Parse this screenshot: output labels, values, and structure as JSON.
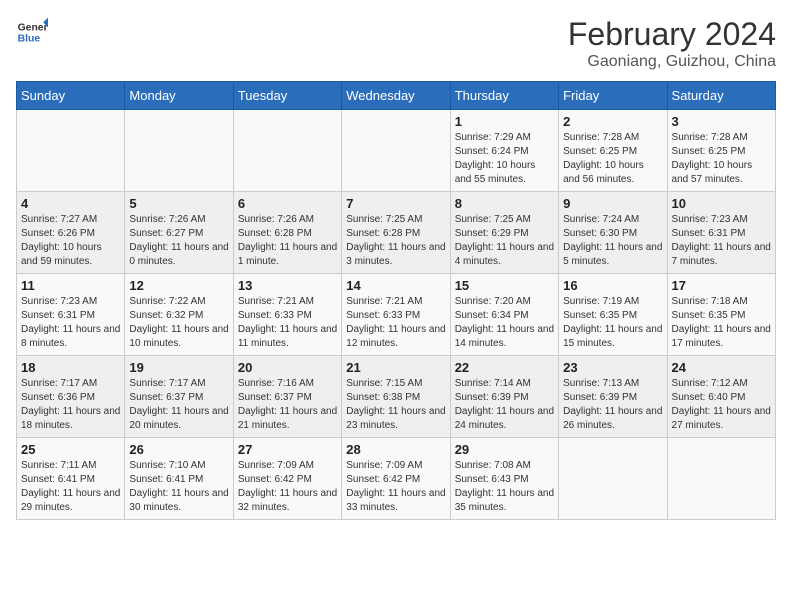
{
  "logo": {
    "line1": "General",
    "line2": "Blue"
  },
  "header": {
    "month": "February 2024",
    "location": "Gaoniang, Guizhou, China"
  },
  "weekdays": [
    "Sunday",
    "Monday",
    "Tuesday",
    "Wednesday",
    "Thursday",
    "Friday",
    "Saturday"
  ],
  "weeks": [
    [
      {
        "day": "",
        "sunrise": "",
        "sunset": "",
        "daylight": ""
      },
      {
        "day": "",
        "sunrise": "",
        "sunset": "",
        "daylight": ""
      },
      {
        "day": "",
        "sunrise": "",
        "sunset": "",
        "daylight": ""
      },
      {
        "day": "",
        "sunrise": "",
        "sunset": "",
        "daylight": ""
      },
      {
        "day": "1",
        "sunrise": "Sunrise: 7:29 AM",
        "sunset": "Sunset: 6:24 PM",
        "daylight": "Daylight: 10 hours and 55 minutes."
      },
      {
        "day": "2",
        "sunrise": "Sunrise: 7:28 AM",
        "sunset": "Sunset: 6:25 PM",
        "daylight": "Daylight: 10 hours and 56 minutes."
      },
      {
        "day": "3",
        "sunrise": "Sunrise: 7:28 AM",
        "sunset": "Sunset: 6:25 PM",
        "daylight": "Daylight: 10 hours and 57 minutes."
      }
    ],
    [
      {
        "day": "4",
        "sunrise": "Sunrise: 7:27 AM",
        "sunset": "Sunset: 6:26 PM",
        "daylight": "Daylight: 10 hours and 59 minutes."
      },
      {
        "day": "5",
        "sunrise": "Sunrise: 7:26 AM",
        "sunset": "Sunset: 6:27 PM",
        "daylight": "Daylight: 11 hours and 0 minutes."
      },
      {
        "day": "6",
        "sunrise": "Sunrise: 7:26 AM",
        "sunset": "Sunset: 6:28 PM",
        "daylight": "Daylight: 11 hours and 1 minute."
      },
      {
        "day": "7",
        "sunrise": "Sunrise: 7:25 AM",
        "sunset": "Sunset: 6:28 PM",
        "daylight": "Daylight: 11 hours and 3 minutes."
      },
      {
        "day": "8",
        "sunrise": "Sunrise: 7:25 AM",
        "sunset": "Sunset: 6:29 PM",
        "daylight": "Daylight: 11 hours and 4 minutes."
      },
      {
        "day": "9",
        "sunrise": "Sunrise: 7:24 AM",
        "sunset": "Sunset: 6:30 PM",
        "daylight": "Daylight: 11 hours and 5 minutes."
      },
      {
        "day": "10",
        "sunrise": "Sunrise: 7:23 AM",
        "sunset": "Sunset: 6:31 PM",
        "daylight": "Daylight: 11 hours and 7 minutes."
      }
    ],
    [
      {
        "day": "11",
        "sunrise": "Sunrise: 7:23 AM",
        "sunset": "Sunset: 6:31 PM",
        "daylight": "Daylight: 11 hours and 8 minutes."
      },
      {
        "day": "12",
        "sunrise": "Sunrise: 7:22 AM",
        "sunset": "Sunset: 6:32 PM",
        "daylight": "Daylight: 11 hours and 10 minutes."
      },
      {
        "day": "13",
        "sunrise": "Sunrise: 7:21 AM",
        "sunset": "Sunset: 6:33 PM",
        "daylight": "Daylight: 11 hours and 11 minutes."
      },
      {
        "day": "14",
        "sunrise": "Sunrise: 7:21 AM",
        "sunset": "Sunset: 6:33 PM",
        "daylight": "Daylight: 11 hours and 12 minutes."
      },
      {
        "day": "15",
        "sunrise": "Sunrise: 7:20 AM",
        "sunset": "Sunset: 6:34 PM",
        "daylight": "Daylight: 11 hours and 14 minutes."
      },
      {
        "day": "16",
        "sunrise": "Sunrise: 7:19 AM",
        "sunset": "Sunset: 6:35 PM",
        "daylight": "Daylight: 11 hours and 15 minutes."
      },
      {
        "day": "17",
        "sunrise": "Sunrise: 7:18 AM",
        "sunset": "Sunset: 6:35 PM",
        "daylight": "Daylight: 11 hours and 17 minutes."
      }
    ],
    [
      {
        "day": "18",
        "sunrise": "Sunrise: 7:17 AM",
        "sunset": "Sunset: 6:36 PM",
        "daylight": "Daylight: 11 hours and 18 minutes."
      },
      {
        "day": "19",
        "sunrise": "Sunrise: 7:17 AM",
        "sunset": "Sunset: 6:37 PM",
        "daylight": "Daylight: 11 hours and 20 minutes."
      },
      {
        "day": "20",
        "sunrise": "Sunrise: 7:16 AM",
        "sunset": "Sunset: 6:37 PM",
        "daylight": "Daylight: 11 hours and 21 minutes."
      },
      {
        "day": "21",
        "sunrise": "Sunrise: 7:15 AM",
        "sunset": "Sunset: 6:38 PM",
        "daylight": "Daylight: 11 hours and 23 minutes."
      },
      {
        "day": "22",
        "sunrise": "Sunrise: 7:14 AM",
        "sunset": "Sunset: 6:39 PM",
        "daylight": "Daylight: 11 hours and 24 minutes."
      },
      {
        "day": "23",
        "sunrise": "Sunrise: 7:13 AM",
        "sunset": "Sunset: 6:39 PM",
        "daylight": "Daylight: 11 hours and 26 minutes."
      },
      {
        "day": "24",
        "sunrise": "Sunrise: 7:12 AM",
        "sunset": "Sunset: 6:40 PM",
        "daylight": "Daylight: 11 hours and 27 minutes."
      }
    ],
    [
      {
        "day": "25",
        "sunrise": "Sunrise: 7:11 AM",
        "sunset": "Sunset: 6:41 PM",
        "daylight": "Daylight: 11 hours and 29 minutes."
      },
      {
        "day": "26",
        "sunrise": "Sunrise: 7:10 AM",
        "sunset": "Sunset: 6:41 PM",
        "daylight": "Daylight: 11 hours and 30 minutes."
      },
      {
        "day": "27",
        "sunrise": "Sunrise: 7:09 AM",
        "sunset": "Sunset: 6:42 PM",
        "daylight": "Daylight: 11 hours and 32 minutes."
      },
      {
        "day": "28",
        "sunrise": "Sunrise: 7:09 AM",
        "sunset": "Sunset: 6:42 PM",
        "daylight": "Daylight: 11 hours and 33 minutes."
      },
      {
        "day": "29",
        "sunrise": "Sunrise: 7:08 AM",
        "sunset": "Sunset: 6:43 PM",
        "daylight": "Daylight: 11 hours and 35 minutes."
      },
      {
        "day": "",
        "sunrise": "",
        "sunset": "",
        "daylight": ""
      },
      {
        "day": "",
        "sunrise": "",
        "sunset": "",
        "daylight": ""
      }
    ]
  ]
}
